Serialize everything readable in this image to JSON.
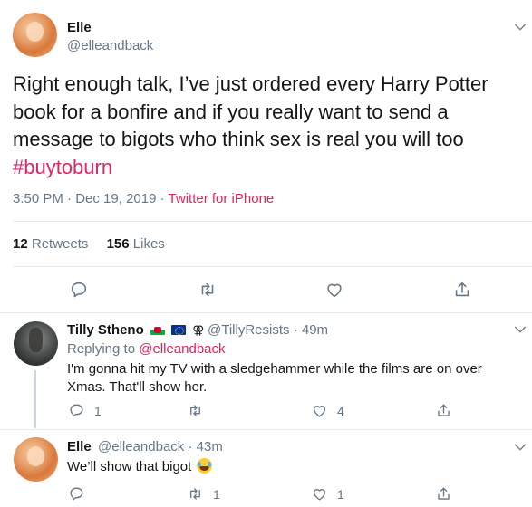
{
  "main_tweet": {
    "name": "Elle",
    "handle": "@elleandback",
    "text_before_hashtag": "Right enough talk, I’ve just ordered every Harry Potter book for a bonfire and if you really want to send a message to bigots who think sex is real you will too",
    "hashtag": "#buytoburn",
    "time": "3:50 PM",
    "separator": "·",
    "date": "Dec 19, 2019",
    "source": "Twitter for iPhone",
    "retweets_count": "12",
    "retweets_label": "Retweets",
    "likes_count": "156",
    "likes_label": "Likes"
  },
  "replies": [
    {
      "name": "Tilly Stheno",
      "flags": [
        "wales-flag",
        "eu-flag"
      ],
      "glyph": "⚢",
      "handle": "@TillyResists",
      "time": "49m",
      "replying_prefix": "Replying to",
      "replying_to": "@elleandback",
      "text": "I'm gonna hit my TV with a sledgehammer while the films are on over Xmas. That'll show her.",
      "reply_count": "1",
      "retweet_count": "",
      "like_count": "4"
    },
    {
      "name": "Elle",
      "handle": "@elleandback",
      "time": "43m",
      "text": "We’ll show that bigot",
      "emoji": "face-with-tears-of-joy",
      "reply_count": "",
      "retweet_count": "1",
      "like_count": "1"
    }
  ],
  "icons": {
    "reply": "reply-icon",
    "retweet": "retweet-icon",
    "like": "heart-icon",
    "share": "share-icon",
    "more": "chevron-down-icon"
  },
  "colors": {
    "accent": "#e0245e",
    "secondary_text": "#657786",
    "divider": "#e6ecf0"
  }
}
